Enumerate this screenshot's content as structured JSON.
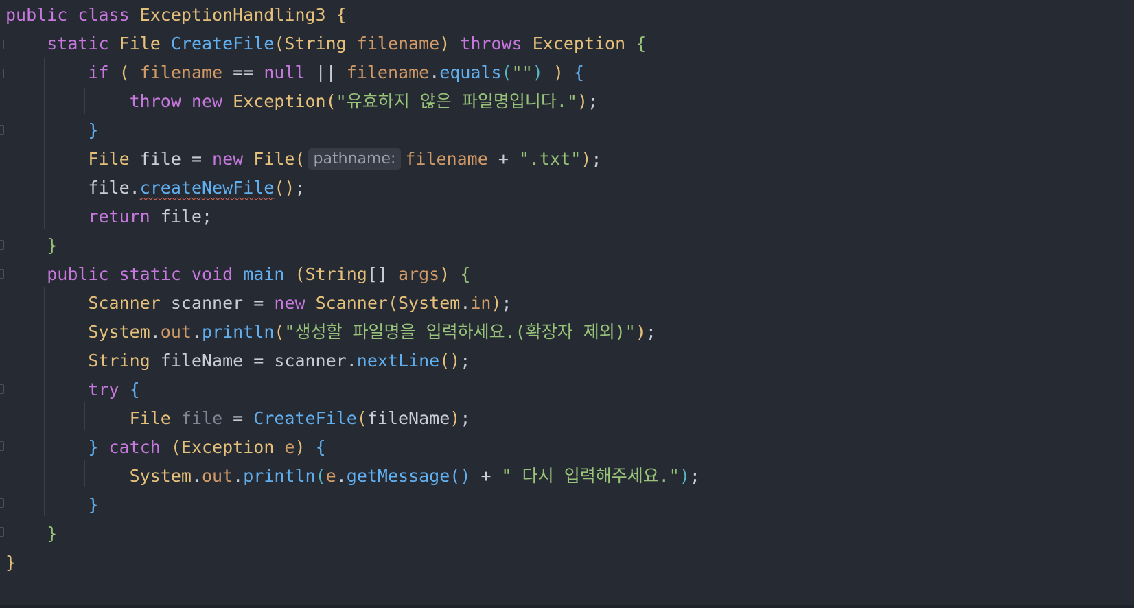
{
  "editor": {
    "language": "java",
    "class_name": "ExceptionHandling3",
    "method_create": "CreateFile",
    "param_filename": "filename",
    "exception_type": "Exception",
    "error_message": "\"유효하지 않은 파일명입니다.\"",
    "parameter_hint": "pathname:",
    "txt_suffix": "\".txt\"",
    "create_new_file": "createNewFile",
    "prompt_message": "\"생성할 파일명을 입력하세요.(확장자 제외)\"",
    "next_line": "nextLine",
    "retry_message": "\" 다시 입력해주세요.\"",
    "empty_string": "\"\"",
    "colors": {
      "background": "#262a33",
      "keyword": "#c678dd",
      "type": "#e5c07b",
      "function": "#61afef",
      "variable": "#d19a66",
      "string": "#98c379",
      "plain": "#c9ced6"
    }
  }
}
